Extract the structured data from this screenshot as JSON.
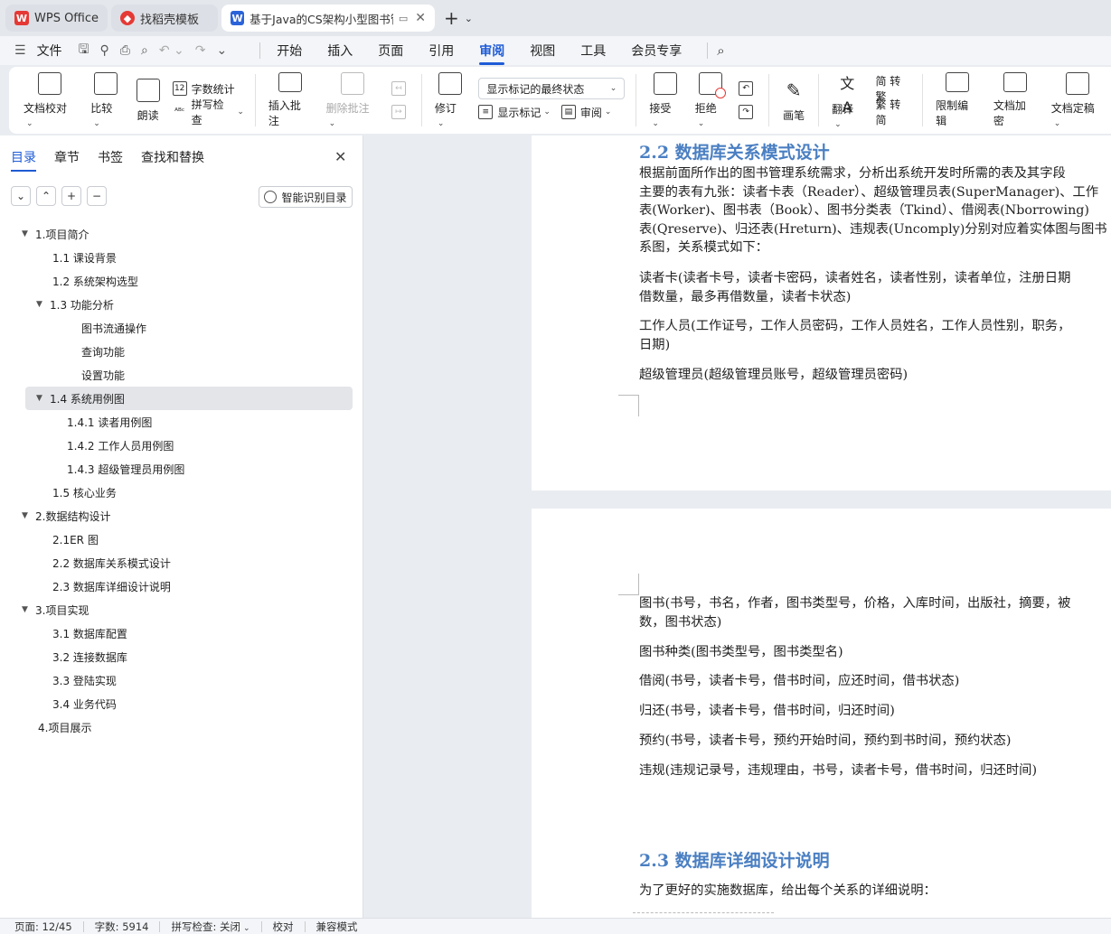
{
  "tabs": [
    {
      "label": "WPS Office",
      "icon": "wps-logo-icon"
    },
    {
      "label": "找稻壳模板",
      "icon": "docer-icon"
    },
    {
      "label": "基于Java的CS架构小型图书管",
      "icon": "word-doc-icon"
    }
  ],
  "menu": {
    "file": "文件",
    "items": [
      "开始",
      "插入",
      "页面",
      "引用",
      "审阅",
      "视图",
      "工具",
      "会员专享"
    ],
    "active": "审阅"
  },
  "ribbon": {
    "doc_check": "文档校对",
    "compare": "比较",
    "read_aloud": "朗读",
    "word_count": "字数统计",
    "spell_check": "拼写检查",
    "insert_comment": "插入批注",
    "delete_comment": "删除批注",
    "track_changes": "修订",
    "markup_state": "显示标记的最终状态",
    "show_markup": "显示标记",
    "review": "审阅",
    "accept": "接受",
    "reject": "拒绝",
    "pen": "画笔",
    "translate": "翻译",
    "to_traditional": "简 转繁",
    "to_simplified": "繁 转简",
    "restrict_edit": "限制编辑",
    "encrypt": "文档加密",
    "finalize": "文档定稿"
  },
  "nav": {
    "tabs": [
      "目录",
      "章节",
      "书签",
      "查找和替换"
    ],
    "smart_button": "智能识别目录",
    "toc": [
      {
        "label": "1.项目简介",
        "level": 1,
        "tri": true
      },
      {
        "label": "1.1 课设背景",
        "level": 2
      },
      {
        "label": "1.2 系统架构选型",
        "level": 2
      },
      {
        "label": "1.3 功能分析",
        "level": 2,
        "tri": true
      },
      {
        "label": "图书流通操作",
        "level": 4
      },
      {
        "label": "查询功能",
        "level": 4
      },
      {
        "label": "设置功能",
        "level": 4
      },
      {
        "label": "1.4 系统用例图",
        "level": 2,
        "tri": true,
        "selected": true
      },
      {
        "label": "1.4.1 读者用例图",
        "level": 3
      },
      {
        "label": "1.4.2 工作人员用例图",
        "level": 3
      },
      {
        "label": "1.4.3 超级管理员用例图",
        "level": 3
      },
      {
        "label": "1.5 核心业务",
        "level": 2
      },
      {
        "label": "2.数据结构设计",
        "level": 1,
        "tri": true
      },
      {
        "label": "2.1ER 图",
        "level": 2
      },
      {
        "label": "2.2 数据库关系模式设计",
        "level": 2
      },
      {
        "label": "2.3 数据库详细设计说明",
        "level": 2
      },
      {
        "label": "3.项目实现",
        "level": 1,
        "tri": true
      },
      {
        "label": "3.1 数据库配置",
        "level": 2
      },
      {
        "label": "3.2 连接数据库",
        "level": 2
      },
      {
        "label": "3.3 登陆实现",
        "level": 2
      },
      {
        "label": "3.4 业务代码",
        "level": 2
      },
      {
        "label": "4.项目展示",
        "level": 1
      }
    ]
  },
  "doc": {
    "page1": {
      "heading": "2.2 数据库关系模式设计",
      "p1": [
        "根据前面所作出的图书管理系统需求，分析出系统开发时所需的表及其字段",
        "主要的表有九张：读者卡表（Reader）、超级管理员表(SuperManager)、工作",
        "表(Worker)、图书表（Book）、图书分类表（Tkind）、借阅表(Nborrowing)",
        "表(Qreserve)、归还表(Hreturn)、违规表(Uncomply)分别对应着实体图与图书",
        "系图，关系模式如下："
      ],
      "p2": [
        "读者卡(读者卡号，读者卡密码，读者姓名，读者性别，读者单位，注册日期",
        "借数量，最多再借数量，读者卡状态)"
      ],
      "p3": [
        "工作人员(工作证号，工作人员密码，工作人员姓名，工作人员性别，职务，",
        "日期)"
      ],
      "p4": "超级管理员(超级管理员账号，超级管理员密码)"
    },
    "page2": {
      "p1": [
        "图书(书号，书名，作者，图书类型号，价格，入库时间，出版社，摘要，被",
        "数，图书状态)"
      ],
      "p2": "图书种类(图书类型号，图书类型名)",
      "p3": "借阅(书号，读者卡号，借书时间，应还时间，借书状态)",
      "p4": "归还(书号，读者卡号，借书时间，归还时间)",
      "p5": "预约(书号，读者卡号，预约开始时间，预约到书时间，预约状态)",
      "p6": "违规(违规记录号，违规理由，书号，读者卡号，借书时间，归还时间)",
      "heading": "2.3 数据库详细设计说明",
      "p7": "为了更好的实施数据库，给出每个关系的详细说明："
    }
  },
  "status": {
    "page": "页面: 12/45",
    "words": "字数: 5914",
    "spell": "拼写检查: 关闭",
    "proof": "校对",
    "compat": "兼容模式"
  },
  "colors": {
    "accent": "#1e5bd6",
    "heading": "#4a7fc2"
  }
}
